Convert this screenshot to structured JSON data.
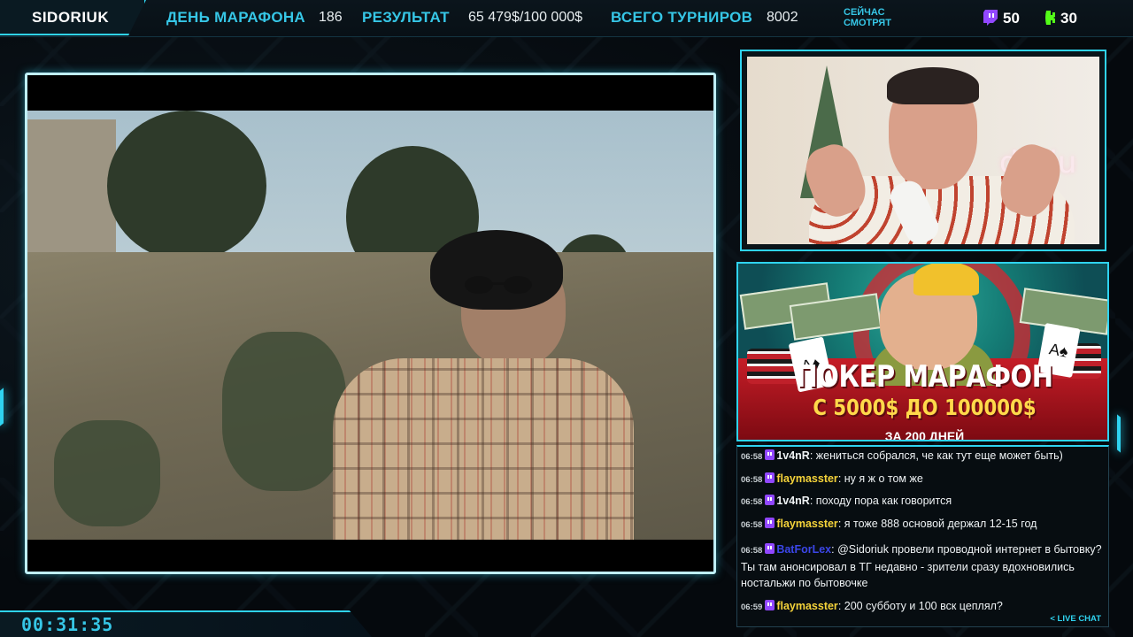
{
  "header": {
    "brand": "SIDORIUK",
    "stats": [
      {
        "label": "ДЕНЬ МАРАФОНА",
        "value": "186"
      },
      {
        "label": "РЕЗУЛЬТАТ",
        "value": "65 479$/100 000$"
      },
      {
        "label": "ВСЕГО ТУРНИРОВ",
        "value": "8002"
      }
    ],
    "watching_label": "СЕЙЧАС СМОТРЯТ",
    "twitch_count": "50",
    "kick_count": "30",
    "icons": {
      "twitch": "twitch-icon",
      "kick": "kick-icon"
    },
    "accent_color": "#2fd3f0",
    "label_color": "#36c6e6"
  },
  "poster": {
    "title": "ПОКЕР МАРАФОН",
    "subtitle": "С 5000$ ДО 100000$",
    "subtitle2": "ЗА 200 ДНЕЙ"
  },
  "chat": {
    "messages": [
      {
        "time": "06:58",
        "user": "1v4nR",
        "user_color": "#f2f2f2",
        "text": "жениться собрался, че как тут еще может быть)"
      },
      {
        "time": "06:58",
        "user": "flaymasster",
        "user_color": "#f5d33a",
        "text": "ну я ж о том же"
      },
      {
        "time": "06:58",
        "user": "1v4nR",
        "user_color": "#f2f2f2",
        "text": "походу пора как говорится"
      },
      {
        "time": "06:58",
        "user": "flaymasster",
        "user_color": "#f5d33a",
        "text": "я тоже 888 основой держал 12-15 год"
      },
      {
        "time": "06:58",
        "user": "BatForLex",
        "user_color": "#3b46e8",
        "text": "@Sidoriuk провели проводной интернет в бытовку? Ты там анонсировал в ТГ недавно - зрители сразу вдохновились ностальжи по бытовочке"
      },
      {
        "time": "06:59",
        "user": "flaymasster",
        "user_color": "#f5d33a",
        "text": "200 субботу и 100 вск цеплял?"
      }
    ],
    "live_prefix": "< ",
    "live_label": "LIVE",
    "chat_label": "CHAT"
  },
  "timer": "00:31:35"
}
